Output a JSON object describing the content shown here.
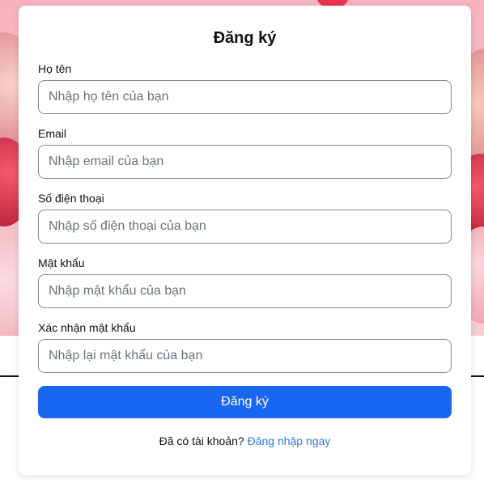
{
  "form": {
    "title": "Đăng ký",
    "fields": [
      {
        "label": "Họ tên",
        "placeholder": "Nhập họ tên của bạn",
        "value": ""
      },
      {
        "label": "Email",
        "placeholder": "Nhập email của bạn",
        "value": ""
      },
      {
        "label": "Số điện thoại",
        "placeholder": "Nhập số điện thoại của bạn",
        "value": ""
      },
      {
        "label": "Mật khẩu",
        "placeholder": "Nhập mật khẩu của bạn",
        "value": ""
      },
      {
        "label": "Xác nhận mật khẩu",
        "placeholder": "Nhập lại mật khẩu của bạn",
        "value": ""
      }
    ],
    "submit_label": "Đăng ký",
    "footer_text": "Đã có tài khoản?",
    "footer_link": "Đăng nhập ngay"
  },
  "colors": {
    "primary_button": "#1a66f0",
    "link": "#2b7de9",
    "background_pink": "#f6b3bf"
  }
}
